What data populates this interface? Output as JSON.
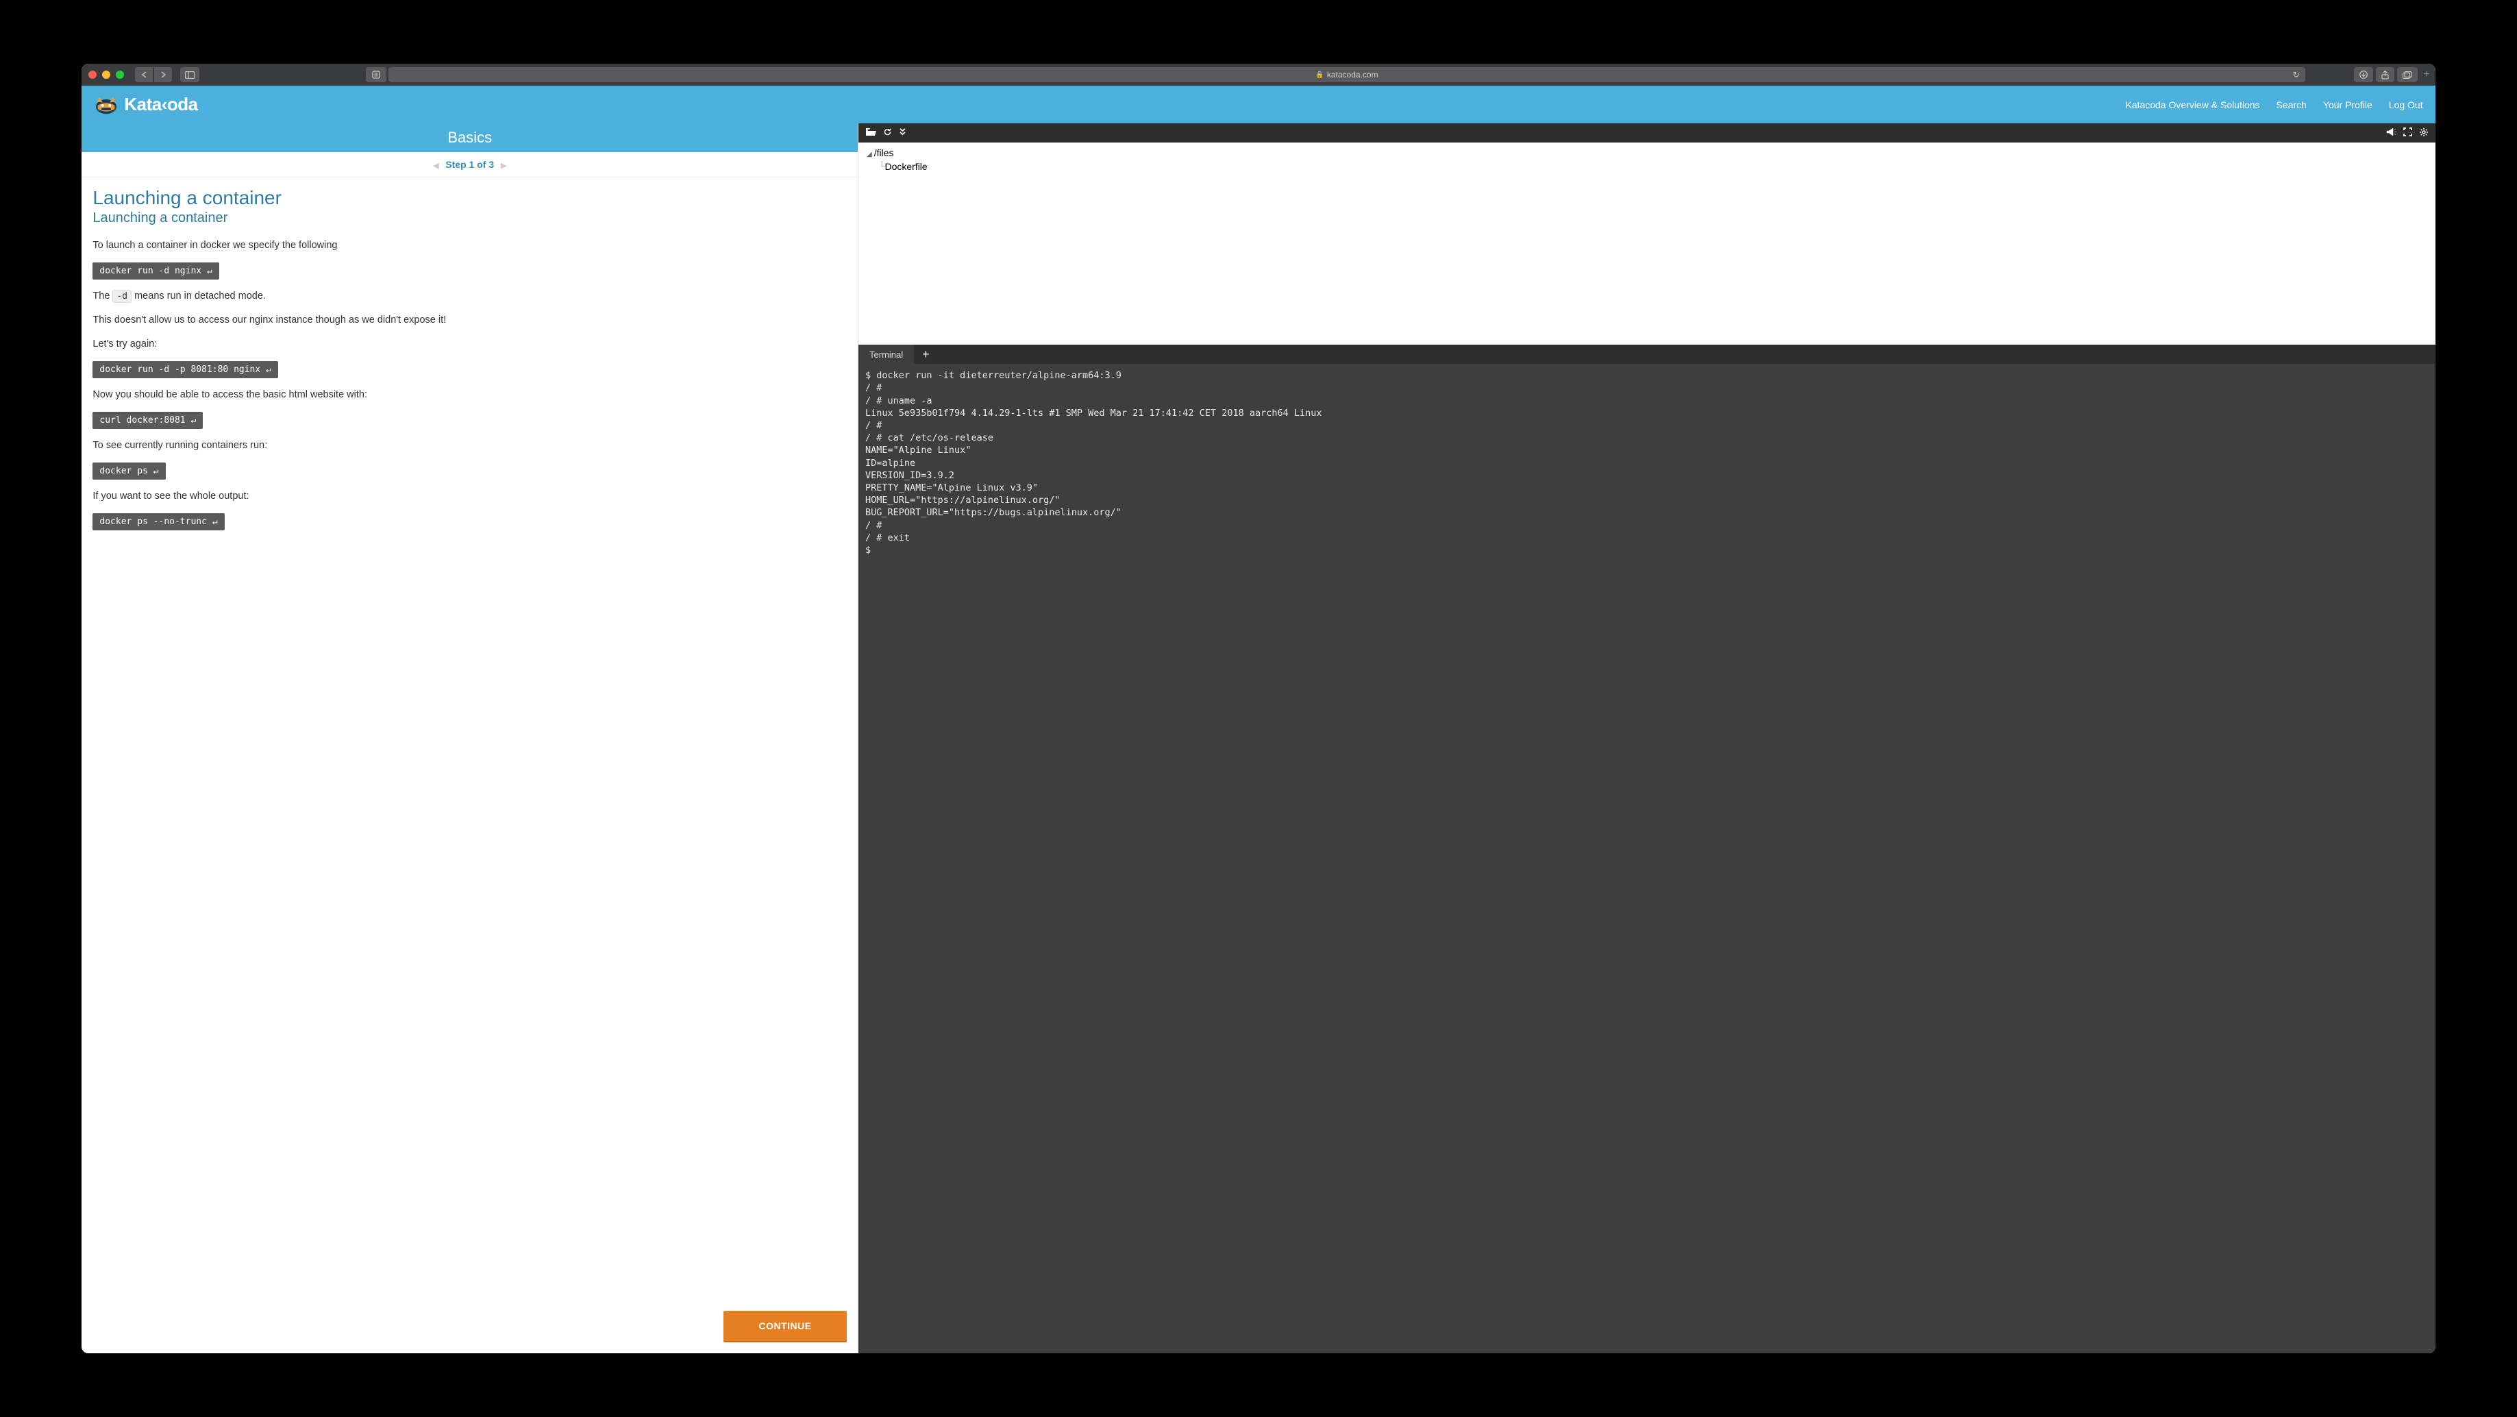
{
  "browser": {
    "url": "katacoda.com"
  },
  "header": {
    "brand": "Kata‹oda",
    "nav": {
      "overview": "Katacoda Overview & Solutions",
      "search": "Search",
      "profile": "Your Profile",
      "logout": "Log Out"
    }
  },
  "lesson": {
    "section": "Basics",
    "step_label": "Step 1 of 3",
    "title": "Launching a container",
    "subtitle": "Launching a container",
    "p1": "To launch a container in docker we specify the following",
    "code1": "docker run -d nginx ↵",
    "p2a": "The ",
    "p2_code": "-d",
    "p2b": " means run in detached mode.",
    "p3": "This doesn't allow us to access our nginx instance though as we didn't expose it!",
    "p4": "Let's try again:",
    "code2": "docker run -d -p 8081:80 nginx ↵",
    "p5": "Now you should be able to access the basic html website with:",
    "code3": "curl docker:8081 ↵",
    "p6": "To see currently running containers run:",
    "code4": "docker ps ↵",
    "p7": "If you want to see the whole output:",
    "code5": "docker ps --no-trunc ↵",
    "continue": "CONTINUE"
  },
  "filetree": {
    "root": "/files",
    "child": "Dockerfile"
  },
  "terminal": {
    "tab": "Terminal",
    "output": "$ docker run -it dieterreuter/alpine-arm64:3.9\n/ #\n/ # uname -a\nLinux 5e935b01f794 4.14.29-1-lts #1 SMP Wed Mar 21 17:41:42 CET 2018 aarch64 Linux\n/ #\n/ # cat /etc/os-release\nNAME=\"Alpine Linux\"\nID=alpine\nVERSION_ID=3.9.2\nPRETTY_NAME=\"Alpine Linux v3.9\"\nHOME_URL=\"https://alpinelinux.org/\"\nBUG_REPORT_URL=\"https://bugs.alpinelinux.org/\"\n/ #\n/ # exit\n$"
  }
}
